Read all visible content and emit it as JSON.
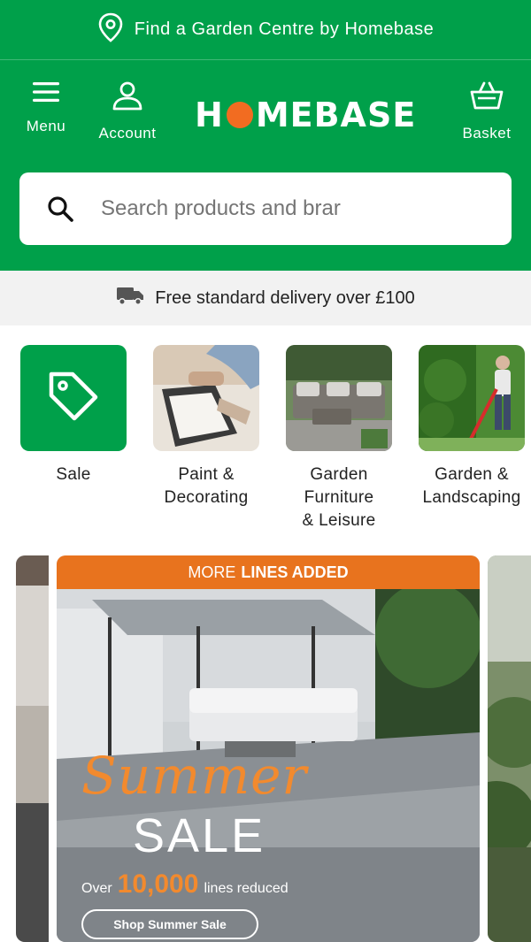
{
  "topbar": {
    "label": "Find a Garden Centre by Homebase"
  },
  "header": {
    "menu_label": "Menu",
    "account_label": "Account",
    "basket_label": "Basket",
    "logo_text_1": "H",
    "logo_text_2": "MEBASE"
  },
  "search": {
    "placeholder": "Search products and brar"
  },
  "delivery": {
    "text": "Free standard delivery over £100"
  },
  "categories": [
    {
      "label": "Sale"
    },
    {
      "label": "Paint &\nDecorating"
    },
    {
      "label": "Garden\nFurniture\n& Leisure"
    },
    {
      "label": "Garden &\nLandscaping"
    }
  ],
  "banner": {
    "top_prefix": "MORE",
    "top_bold": "LINES ADDED",
    "script_text": "Summer",
    "sale_text": "SALE",
    "over_prefix": "Over",
    "over_number": "10,000",
    "over_suffix": "lines reduced",
    "cta": "Shop Summer Sale"
  },
  "colors": {
    "brand_green": "#00a04a",
    "accent_orange": "#f26c21"
  }
}
